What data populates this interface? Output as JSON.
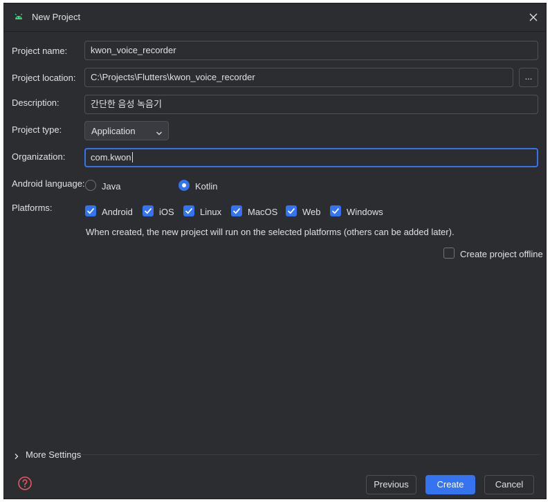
{
  "window": {
    "title": "New Project"
  },
  "form": {
    "project_name": {
      "label": "Project name:",
      "value": "kwon_voice_recorder"
    },
    "project_location": {
      "label": "Project location:",
      "value": "C:\\Projects\\Flutters\\kwon_voice_recorder",
      "browse_label": "..."
    },
    "description": {
      "label": "Description:",
      "value": "간단한 음성 녹음기"
    },
    "project_type": {
      "label": "Project type:",
      "selected": "Application"
    },
    "organization": {
      "label": "Organization:",
      "value": "com.kwon"
    },
    "android_language": {
      "label": "Android language:",
      "options": [
        {
          "label": "Java",
          "selected": false
        },
        {
          "label": "Kotlin",
          "selected": true
        }
      ]
    },
    "platforms": {
      "label": "Platforms:",
      "options": [
        {
          "label": "Android",
          "checked": true
        },
        {
          "label": "iOS",
          "checked": true
        },
        {
          "label": "Linux",
          "checked": true
        },
        {
          "label": "MacOS",
          "checked": true
        },
        {
          "label": "Web",
          "checked": true
        },
        {
          "label": "Windows",
          "checked": true
        }
      ],
      "hint": "When created, the new project will run on the selected platforms (others can be added later)."
    },
    "offline": {
      "label": "Create project offline",
      "checked": false
    }
  },
  "more_settings": {
    "label": "More Settings"
  },
  "footer": {
    "previous_label": "Previous",
    "create_label": "Create",
    "cancel_label": "Cancel"
  },
  "colors": {
    "background": "#2b2d30",
    "accent": "#3574f0",
    "border": "#4e5157",
    "text": "#dfe1e5",
    "android_green": "#3ddc84"
  },
  "icons": {
    "app": "android-icon",
    "close": "close-icon",
    "dropdown": "chevron-down-icon",
    "more_settings": "chevron-right-icon",
    "help": "help-icon",
    "checkbox": "checkmark-icon"
  }
}
